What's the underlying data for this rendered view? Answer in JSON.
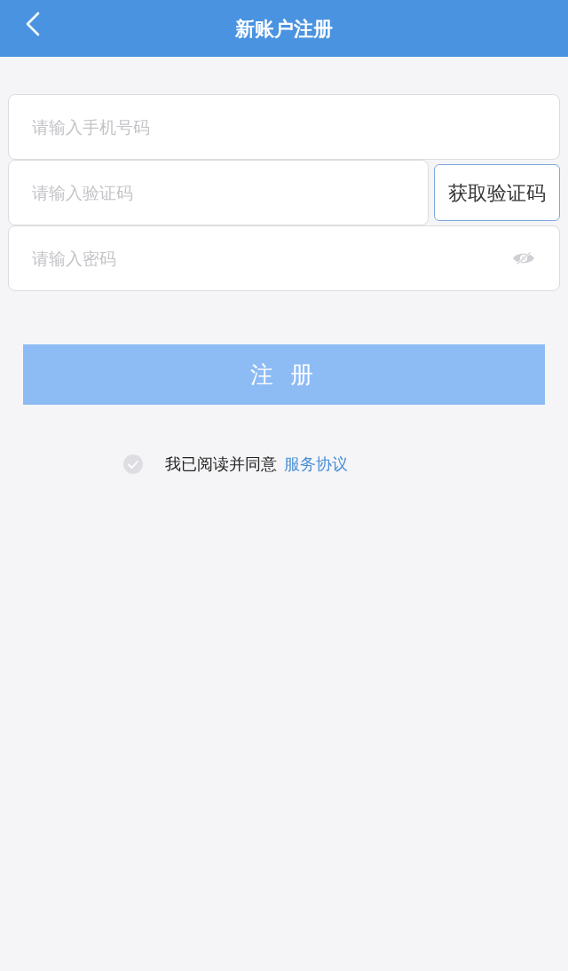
{
  "header": {
    "title": "新账户注册"
  },
  "fields": [
    {
      "kind": "phone",
      "placeholder": "请输入手机号码"
    },
    {
      "kind": "code",
      "placeholder": "请输入验证码",
      "button": "获取验证码"
    },
    {
      "kind": "password",
      "placeholder": "请输入密码"
    }
  ],
  "register_button": {
    "label": "注 册",
    "disabled": true
  },
  "agreement": {
    "checked": false,
    "text": "我已阅读并同意",
    "link": "服务协议"
  }
}
